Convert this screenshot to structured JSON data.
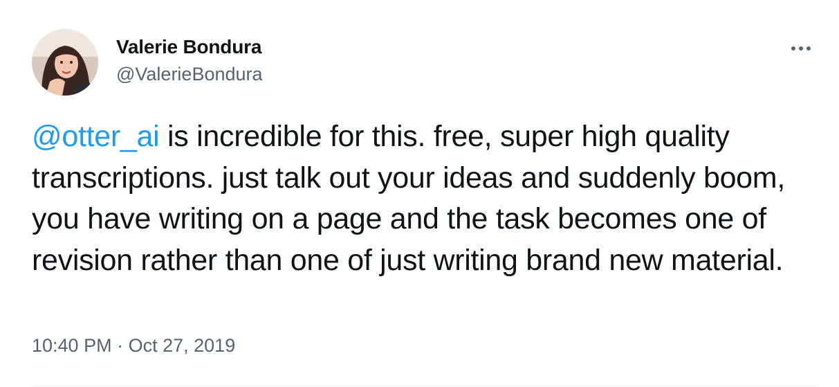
{
  "user": {
    "display_name": "Valerie Bondura",
    "handle": "@ValerieBondura"
  },
  "tweet": {
    "mention": "@otter_ai",
    "body": " is incredible for this. free, super high quality transcriptions. just talk out your ideas and suddenly boom, you have writing on a page and the task becomes one of revision rather than one of just writing brand new material.",
    "time": "10:40 PM",
    "separator": "·",
    "date": "Oct 27, 2019"
  },
  "icons": {
    "more": "more-horizontal-icon",
    "avatar": "avatar"
  },
  "colors": {
    "text": "#0f1419",
    "secondary": "#536471",
    "link": "#1d9bf0",
    "divider": "#eff3f4"
  }
}
